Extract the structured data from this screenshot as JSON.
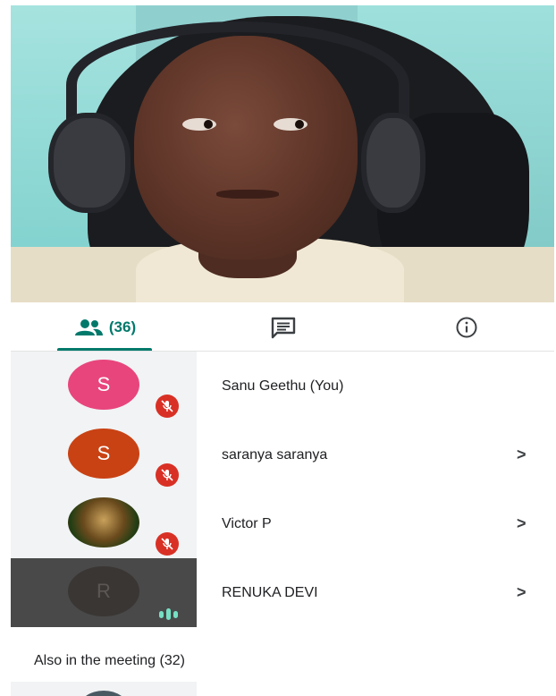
{
  "tabs": {
    "people_count": "(36)",
    "chat_icon": "chat-icon",
    "info_icon": "info-icon",
    "accent": "#00796b"
  },
  "participants": [
    {
      "initial": "S",
      "name": "Sanu Geethu (You)",
      "muted": true,
      "chevron": ""
    },
    {
      "initial": "S",
      "name": "saranya saranya",
      "muted": true,
      "chevron": ">"
    },
    {
      "initial": "",
      "name": "Victor P",
      "muted": true,
      "chevron": ">"
    },
    {
      "initial": "R",
      "name": "RENUKA DEVI",
      "muted": false,
      "speaking": true,
      "chevron": ">"
    }
  ],
  "also_in_meeting": "Also in the meeting (32)",
  "colors": {
    "muted_badge": "#d93025",
    "speaking_tile": "#494949",
    "avatar_pink": "#e8457c",
    "avatar_orange": "#c94214"
  }
}
